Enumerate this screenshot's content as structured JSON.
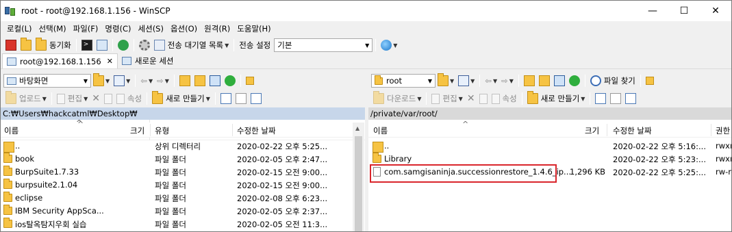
{
  "window": {
    "title": "root - root@192.168.1.156 - WinSCP",
    "controls": [
      "—",
      "☐",
      "✕"
    ]
  },
  "menu": [
    "로컬(L)",
    "선택(M)",
    "파일(F)",
    "명령(C)",
    "세션(S)",
    "옵션(O)",
    "원격(R)",
    "도움말(H)"
  ],
  "toolbar": {
    "sync_label": "동기화",
    "queue_label": "전송 대기열 목록",
    "transfer_settings_label": "전송 설정",
    "transfer_settings_value": "기본"
  },
  "tabs": {
    "session": "root@192.168.1.156",
    "new_session": "새로운 세션"
  },
  "left": {
    "drive": "바탕화면",
    "upload": "업로드",
    "edit": "편집",
    "properties": "속성",
    "new": "새로 만들기",
    "path": "C:₩Users₩hackcatml₩Desktop₩",
    "columns": {
      "name": "이름",
      "size": "크기",
      "type": "유형",
      "modified": "수정한 날짜"
    },
    "rows": [
      {
        "name": "..",
        "size": "",
        "type": "상위 디렉터리",
        "modified": "2020-02-22  오후 5:25..."
      },
      {
        "name": "book",
        "size": "",
        "type": "파일 폴더",
        "modified": "2020-02-05  오후 2:47..."
      },
      {
        "name": "BurpSuite1.7.33",
        "size": "",
        "type": "파일 폴더",
        "modified": "2020-02-15  오전 9:00..."
      },
      {
        "name": "burpsuite2.1.04",
        "size": "",
        "type": "파일 폴더",
        "modified": "2020-02-15  오전 9:00..."
      },
      {
        "name": "eclipse",
        "size": "",
        "type": "파일 폴더",
        "modified": "2020-02-08  오후 6:23..."
      },
      {
        "name": "IBM Security AppSca...",
        "size": "",
        "type": "파일 폴더",
        "modified": "2020-02-05  오후 2:37..."
      },
      {
        "name": "ios탈옥탐지우회 실습",
        "size": "",
        "type": "파일 폴더",
        "modified": "2020-02-05  오전 11:3..."
      }
    ]
  },
  "right": {
    "dir": "root",
    "find_label": "파일 찾기",
    "download": "다운로드",
    "edit": "편집",
    "properties": "속성",
    "new": "새로 만들기",
    "path": "/private/var/root/",
    "columns": {
      "name": "이름",
      "size": "크기",
      "modified": "수정한 날짜",
      "rights": "권한"
    },
    "rows": [
      {
        "name": "..",
        "size": "",
        "modified": "2020-02-22  오후 5:16:...",
        "rights": "rwxr"
      },
      {
        "name": "Library",
        "size": "",
        "modified": "2020-02-22  오후 5:23:...",
        "rights": "rwxr"
      },
      {
        "name": "com.samgisaninja.successionrestore_1.4.6_ip...",
        "size": "1,296 KB",
        "modified": "2020-02-22  오후 5:25:...",
        "rights": "rw-r-"
      }
    ]
  }
}
